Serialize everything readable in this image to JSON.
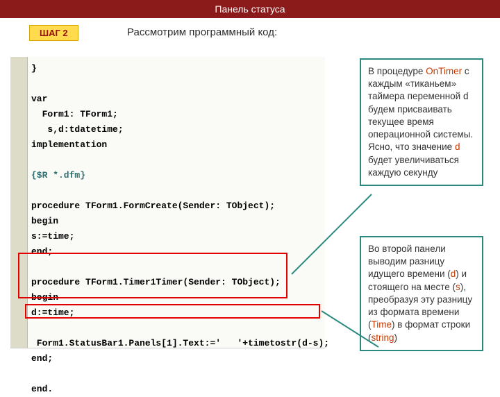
{
  "header": {
    "title": "Панель статуса"
  },
  "step_badge": {
    "label": "ШАГ 2"
  },
  "prompt": {
    "text": "Рассмотрим программный код:"
  },
  "code": {
    "line_end_brace": "}",
    "var": "var",
    "var_form1": "  Form1: TForm1;",
    "var_sd": "   s,d:tdatetime;",
    "impl": "implementation",
    "directive": "{$R *.dfm}",
    "proc1_sig": "procedure TForm1.FormCreate(Sender: TObject);",
    "begin1": "begin",
    "body1": "s:=time;",
    "end1": "end;",
    "proc2_sig": "procedure TForm1.Timer1Timer(Sender: TObject);",
    "begin2": "begin",
    "body2": "d:=time;",
    "body3": " Form1.StatusBar1.Panels[1].Text:='   '+timetostr(d-s);",
    "end2": "end;",
    "endfinal": "end."
  },
  "callout1": {
    "t_pre_1": " В процедуре ",
    "kw_ontimer": "OnTimer",
    "t_post_1": " с каждым «тиканьем» таймера переменной d будем присваивать текущее время операционной системы. Ясно, что значение ",
    "kw_d": "d",
    "t_post_2": " будет увеличиваться каждую секунду"
  },
  "callout2": {
    "t1": " Во второй панели выводим разницу идущего времени (",
    "kw_d": "d",
    "t2": ") и стоящего на месте (",
    "kw_s": "s",
    "t3": "), преобразуя эту разницу из формата времени (",
    "kw_time": "Time",
    "t4": ") в формат строки (",
    "kw_string": "string",
    "t5": ")"
  }
}
